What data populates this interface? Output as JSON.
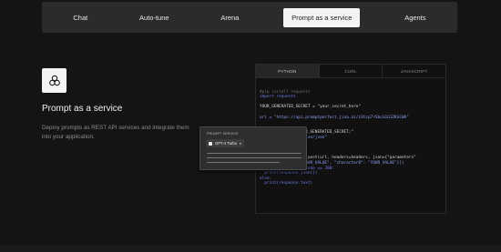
{
  "nav": {
    "tabs": [
      {
        "label": "Chat",
        "active": false
      },
      {
        "label": "Auto-tune",
        "active": false
      },
      {
        "label": "Arena",
        "active": false
      },
      {
        "label": "Prompt as a service",
        "active": true
      },
      {
        "label": "Agents",
        "active": false
      }
    ]
  },
  "feature": {
    "icon": "openai-knot-icon",
    "title": "Prompt as a service",
    "description": "Deploy prompts as REST API services and integrate them into your application."
  },
  "code_panel": {
    "tabs": [
      "PYTHON",
      "CURL",
      "JAVASCRIPT"
    ],
    "active_tab": "PYTHON",
    "lines": [
      "#pip install requests",
      "import requests",
      "",
      "YOUR_GENERATED_SECRET = \"your_secret_here\"",
      "",
      "url = \"https://api.promptperfect.jina.ai/z3tcp7rSbcG1G1ZKSCWA\"",
      "",
      "",
      "                  UR_GENERATED_SECRET;\"",
      "                  tion/json\"",
      "",
      "",
      "",
      "response = requests.post(url, headers=headers, json={\"parameters\"",
      "  {\"character4\": \"YOUR_VALUE\", \"character8\": \"YOUR_VALUE\"}})",
      "if response.status_code == 200:",
      "  print(response.json())",
      "else:",
      "  print(response.text)"
    ]
  },
  "floating_card": {
    "label": "PROMPT SERVICE",
    "model": "GPT-4 Turbo"
  }
}
